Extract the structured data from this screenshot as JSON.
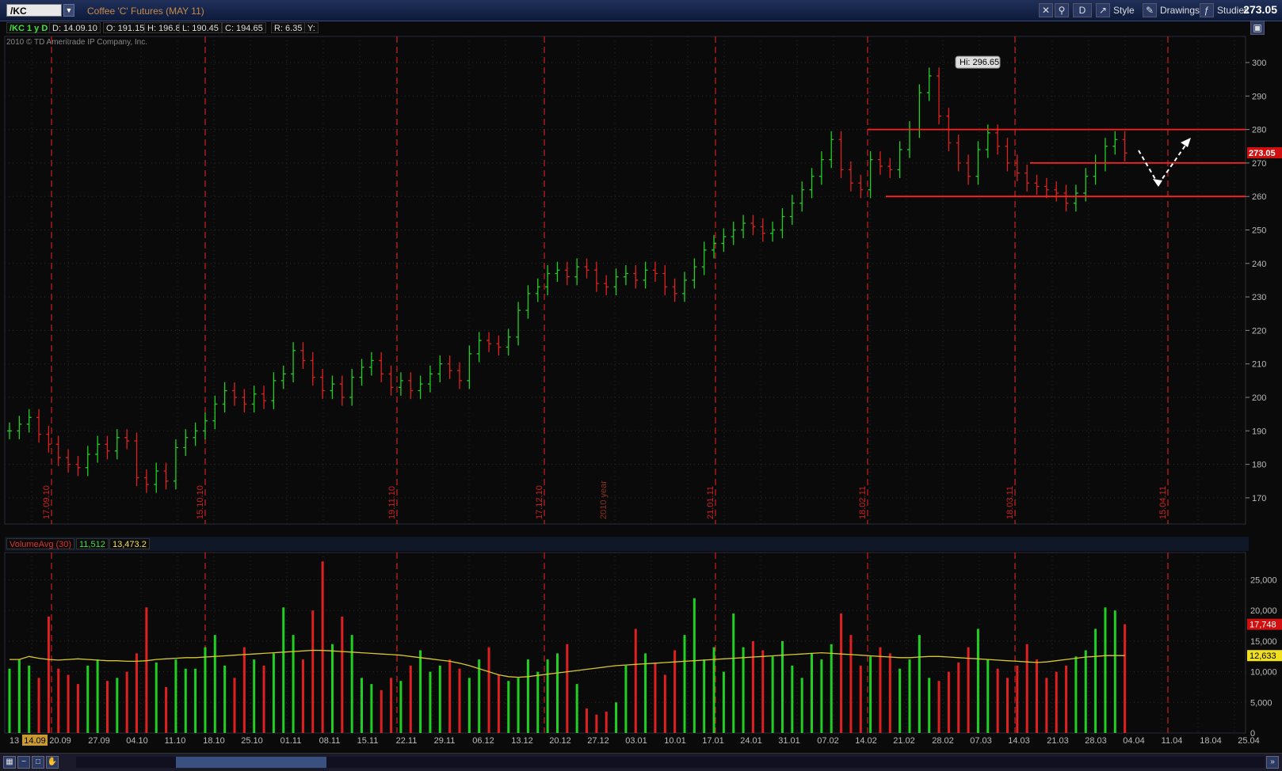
{
  "toolbar": {
    "symbol": "/KC",
    "title": "Coffee 'C' Futures (MAY 11)",
    "period_btn": "D",
    "style_label": "Style",
    "drawings_label": "Drawings",
    "studies_label": "Studies",
    "last_price": "273.05"
  },
  "infobar": {
    "tag": "/KC 1 y D",
    "date": "D: 14.09.10",
    "open": "O: 191.15",
    "high": "H: 196.8",
    "low": "L: 190.45",
    "close": "C: 194.65",
    "range": "R: 6.35",
    "y": "Y:"
  },
  "copyright": "2010 © TD Ameritrade IP Company, Inc.",
  "price_axis": [
    "300",
    "290",
    "280",
    "270",
    "260",
    "250",
    "240",
    "230",
    "220",
    "210",
    "200",
    "190",
    "180",
    "170"
  ],
  "price_markers": {
    "last": "273.05",
    "high_label": "Hi: 296.65"
  },
  "vertical_labels": [
    "17.09.10",
    "15.10.10",
    "19.11.10",
    "17.12.10",
    "2010 year",
    "21.01.11",
    "18.02.11",
    "18.03.11",
    "15.04.11"
  ],
  "volume": {
    "study_label": "VolumeAvg (30)",
    "value1": "11,512",
    "value2": "13,473.2",
    "axis": [
      "25,000",
      "20,000",
      "15,000",
      "10,000",
      "5,000",
      "0"
    ],
    "last_vol_tag": "17,748",
    "avg_tag": "12,633"
  },
  "date_axis": [
    "13",
    "14.09",
    "20.09",
    "27.09",
    "04.10",
    "11.10",
    "18.10",
    "25.10",
    "01.11",
    "08.11",
    "15.11",
    "22.11",
    "29.11",
    "06.12",
    "13.12",
    "20.12",
    "27.12",
    "03.01",
    "10.01",
    "17.01",
    "24.01",
    "31.01",
    "07.02",
    "14.02",
    "21.02",
    "28.02",
    "07.03",
    "14.03",
    "21.03",
    "28.03",
    "04.04",
    "11.04",
    "18.04",
    "25.04"
  ],
  "chart_data": {
    "type": "bar",
    "title": "Coffee 'C' Futures (MAY 11)",
    "ylim": [
      165,
      305
    ],
    "close_series": [
      190,
      192,
      194,
      189,
      186,
      182,
      180,
      179,
      183,
      186,
      184,
      188,
      187,
      176,
      174,
      178,
      175,
      185,
      188,
      190,
      193,
      198,
      202,
      200,
      198,
      201,
      199,
      205,
      207,
      214,
      211,
      206,
      202,
      204,
      200,
      206,
      209,
      211,
      207,
      203,
      205,
      202,
      204,
      207,
      210,
      208,
      205,
      213,
      217,
      216,
      215,
      218,
      226,
      231,
      233,
      237,
      238,
      236,
      239,
      238,
      234,
      233,
      236,
      237,
      235,
      238,
      237,
      233,
      231,
      235,
      239,
      244,
      246,
      248,
      250,
      252,
      251,
      249,
      250,
      254,
      258,
      262,
      266,
      271,
      277,
      268,
      264,
      262,
      271,
      269,
      268,
      274,
      280,
      291,
      296,
      284,
      276,
      270,
      266,
      274,
      279,
      275,
      270,
      267,
      264,
      263,
      262,
      261,
      258,
      261,
      266,
      270,
      275,
      277,
      273
    ],
    "volume_series": [
      10500,
      12000,
      11000,
      9000,
      19000,
      10500,
      9500,
      8000,
      11000,
      12000,
      8500,
      9000,
      10000,
      13000,
      20500,
      11500,
      7500,
      12000,
      10500,
      10500,
      14000,
      16000,
      11000,
      9000,
      14000,
      12000,
      11000,
      13000,
      20500,
      16000,
      12000,
      20000,
      28000,
      14500,
      19000,
      16000,
      9000,
      8000,
      7000,
      9000,
      8500,
      11000,
      13500,
      10000,
      11000,
      12000,
      10500,
      9000,
      12000,
      14000,
      9500,
      8500,
      9000,
      12000,
      10000,
      12000,
      13000,
      14500,
      8000,
      4000,
      3000,
      3500,
      5000,
      11000,
      17000,
      13000,
      11500,
      9500,
      13500,
      16000,
      22000,
      12000,
      14000,
      10000,
      19500,
      14000,
      15000,
      13500,
      12500,
      15000,
      11000,
      9000,
      13000,
      12000,
      14500,
      19500,
      16000,
      11000,
      12500,
      14000,
      13000,
      10500,
      12000,
      16000,
      9000,
      8500,
      10000,
      11500,
      14000,
      17000,
      12000,
      10500,
      9000,
      11000,
      14500,
      12000,
      9000,
      10000,
      11000,
      12500,
      13500,
      17000,
      20500,
      20000,
      17748
    ],
    "volume_avg": [
      12000,
      12000,
      12500,
      12200,
      12000,
      11900,
      12000,
      12100,
      12000,
      11900,
      11800,
      11800,
      11700,
      11700,
      11800,
      12000,
      12100,
      12200,
      12300,
      12300,
      12400,
      12500,
      12600,
      12700,
      12800,
      12900,
      13000,
      13100,
      13200,
      13300,
      13400,
      13500,
      13473,
      13400,
      13300,
      13200,
      13100,
      13000,
      12900,
      12800,
      12700,
      12500,
      12300,
      12100,
      11900,
      11700,
      11400,
      11000,
      10500,
      10000,
      9500,
      9200,
      9100,
      9200,
      9400,
      9600,
      9800,
      10000,
      10200,
      10400,
      10600,
      10800,
      11000,
      11100,
      11200,
      11300,
      11400,
      11500,
      11600,
      11700,
      11800,
      11900,
      12000,
      12100,
      12200,
      12300,
      12400,
      12500,
      12600,
      12700,
      12800,
      12900,
      13000,
      13100,
      13000,
      12900,
      12800,
      12700,
      12600,
      12500,
      12400,
      12300,
      12300,
      12400,
      12500,
      12500,
      12400,
      12300,
      12200,
      12100,
      12000,
      11900,
      11800,
      11700,
      11600,
      11512,
      11600,
      11800,
      12000,
      12200,
      12400,
      12500,
      12633,
      12633,
      12633
    ],
    "resistance_lines": [
      280,
      270,
      260
    ],
    "high": 296.65,
    "last": 273.05
  }
}
